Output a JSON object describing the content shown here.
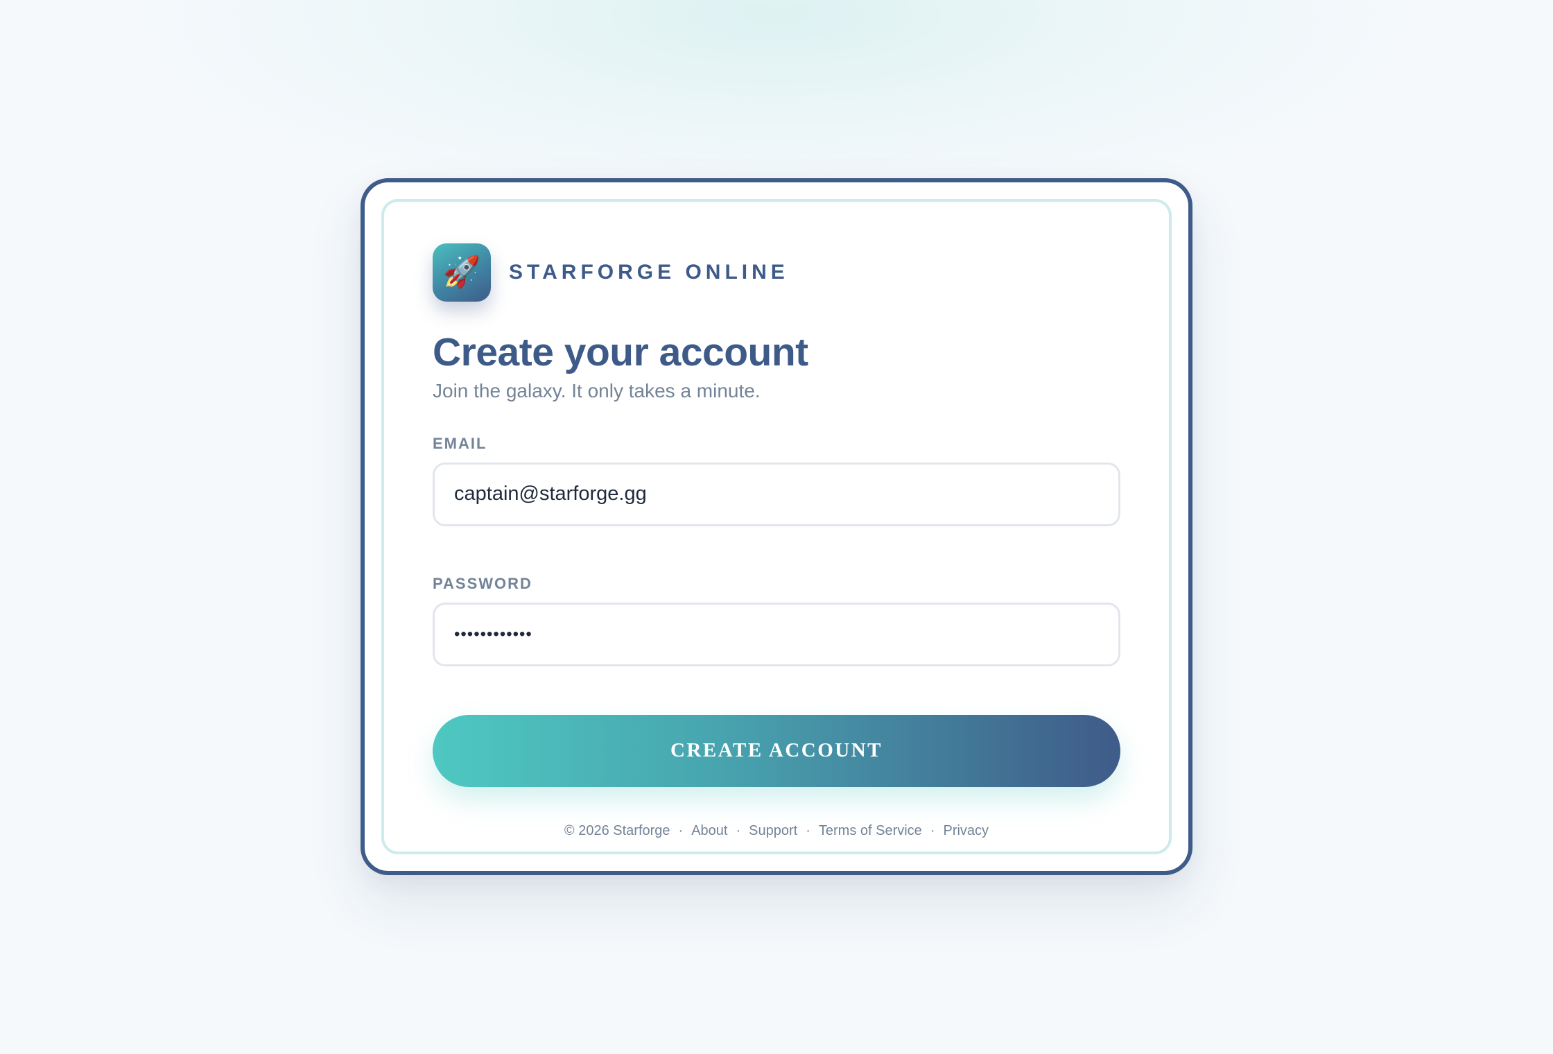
{
  "brand": {
    "logo_icon": "rocket-icon",
    "logo_glyph": "🚀",
    "name": "STARFORGE ONLINE"
  },
  "form": {
    "title": "Create your account",
    "subtitle": "Join the galaxy. It only takes a minute.",
    "email": {
      "label": "EMAIL",
      "value": "captain@starforge.gg"
    },
    "password": {
      "label": "PASSWORD",
      "value": "••••••••••••"
    },
    "submit_label": "CREATE ACCOUNT"
  },
  "footer": {
    "copyright": "© 2026 Starforge",
    "separator": "·",
    "links": [
      "About",
      "Support",
      "Terms of Service",
      "Privacy"
    ]
  },
  "colors": {
    "page_background": "#f5f9fc",
    "card_border": "#3f5b89",
    "inner_border": "#cdebec",
    "heading": "#3d5a88",
    "muted_text": "#738397",
    "accent_teal": "#4ec8c1",
    "accent_navy": "#3f5b89"
  }
}
